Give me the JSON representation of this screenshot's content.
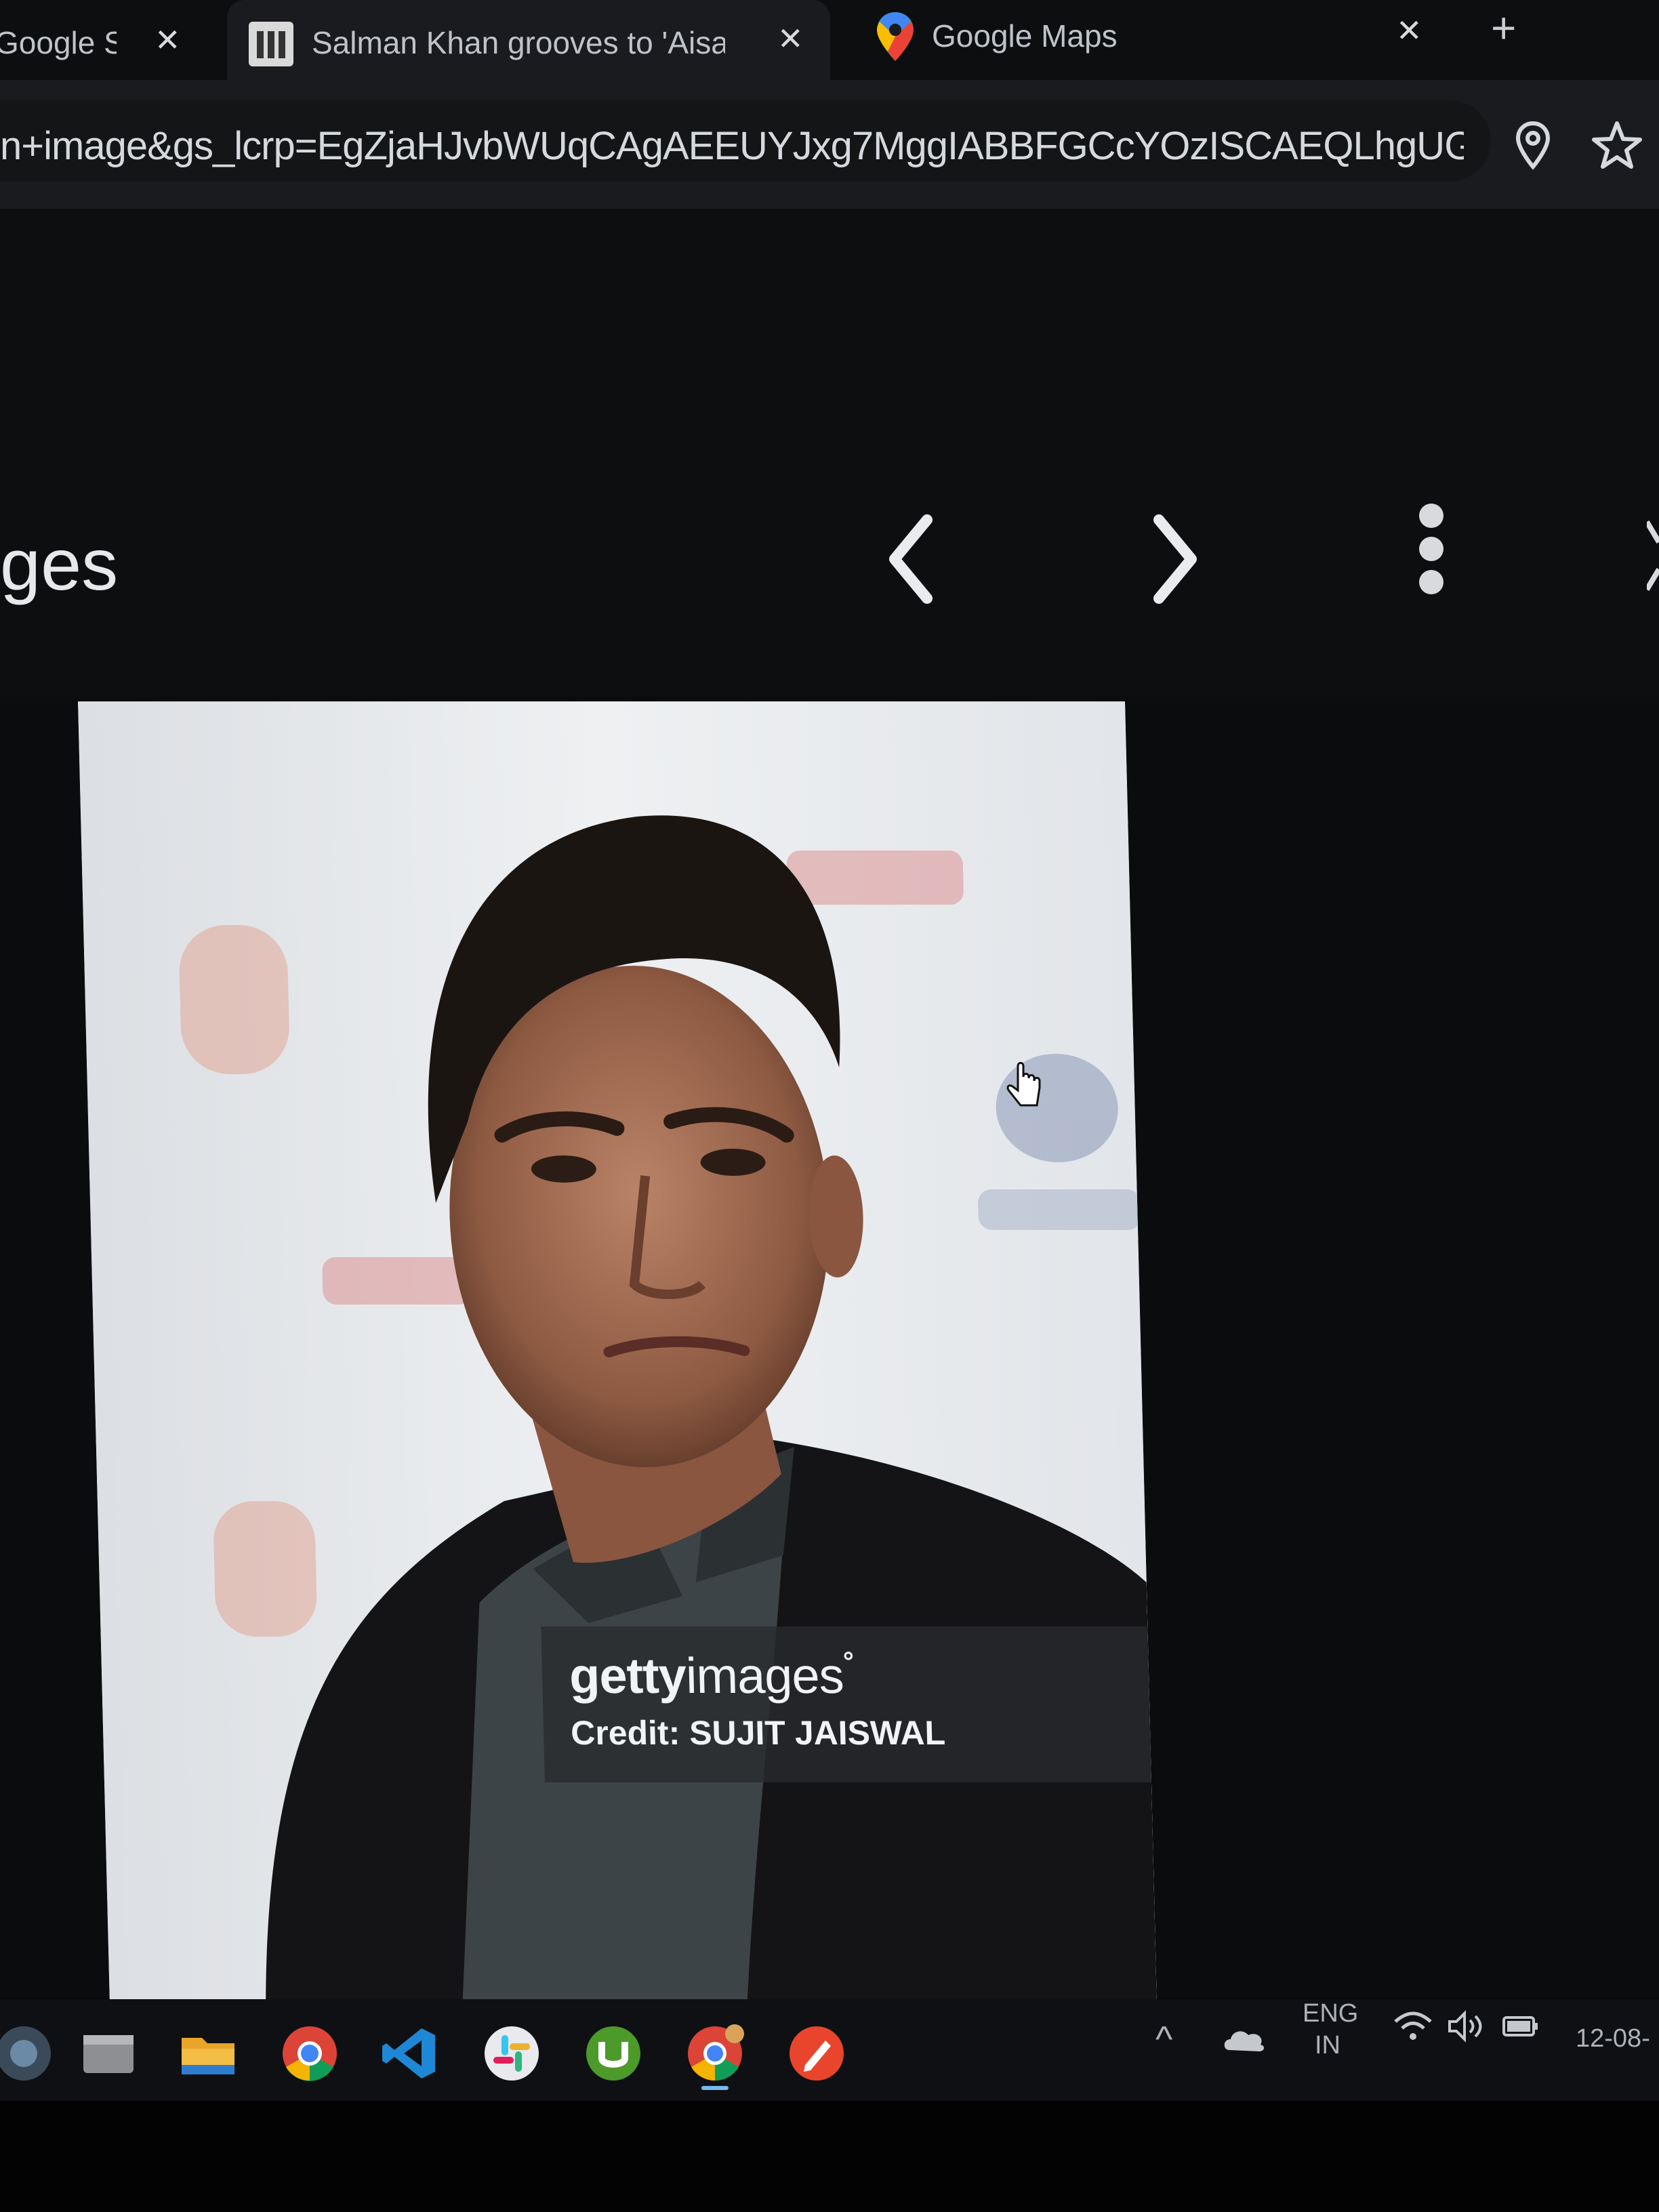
{
  "tabs": [
    {
      "title": "Google S",
      "close": "✕",
      "active": false
    },
    {
      "title": "Salman Khan grooves to 'Aisa",
      "close": "✕",
      "active": true
    },
    {
      "title": "Google Maps",
      "close": "✕",
      "active": false
    }
  ],
  "new_tab": "+",
  "address_bar": {
    "url": "n+image&gs_lcrp=EgZjaHJvbWUqCAgAEEUYJxg7MggIABBFGCcYOzISCAEQLhgUGIMBGIc..."
  },
  "page": {
    "heading": "ges"
  },
  "viewer": {
    "prev": "‹",
    "next": "›",
    "watermark_brand_bold": "getty",
    "watermark_brand_light": "images",
    "watermark_registered": "°",
    "credit": "Credit: SUJIT JAISWAL"
  },
  "taskbar": {
    "apps": [
      "start-icon",
      "file-manager-icon",
      "folder-icon",
      "chrome-icon",
      "vscode-icon",
      "slack-icon",
      "utorrent-icon",
      "chrome-profile-icon",
      "pen-app-icon"
    ],
    "tray_chevron": "^",
    "lang_line1": "ENG",
    "lang_line2": "IN",
    "date": "12-08-"
  },
  "colors": {
    "background": "#0b0c0e",
    "chrome": "#1a1b1e",
    "photo_bg": "#e9ebee"
  }
}
